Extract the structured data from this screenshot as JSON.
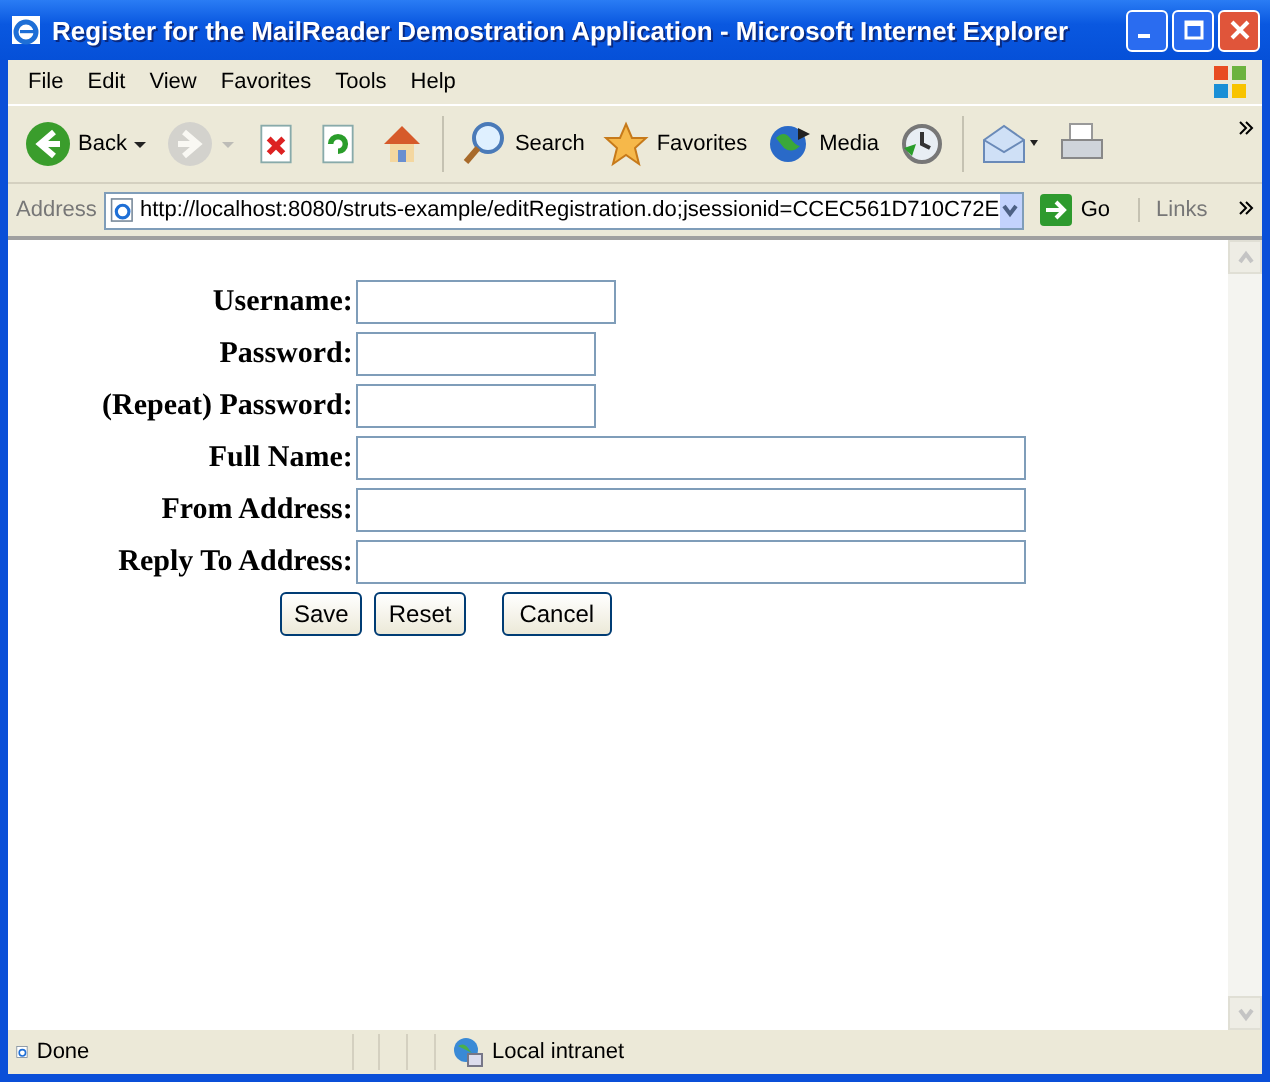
{
  "window": {
    "title": "Register for the MailReader Demostration Application - Microsoft Internet Explorer"
  },
  "menu": [
    "File",
    "Edit",
    "View",
    "Favorites",
    "Tools",
    "Help"
  ],
  "toolbar": [
    {
      "kind": "back",
      "label": "Back",
      "disabled": false
    },
    {
      "kind": "forward",
      "disabled": true
    },
    {
      "kind": "stop",
      "disabled": false
    },
    {
      "kind": "refresh",
      "disabled": false
    },
    {
      "kind": "home",
      "disabled": false
    },
    {
      "kind": "search",
      "label": "Search",
      "disabled": false
    },
    {
      "kind": "favorites",
      "label": "Favorites",
      "disabled": false
    },
    {
      "kind": "media",
      "label": "Media",
      "disabled": false
    },
    {
      "kind": "history",
      "disabled": false
    },
    {
      "kind": "mail",
      "disabled": false
    },
    {
      "kind": "print",
      "disabled": false
    }
  ],
  "address": {
    "label": "Address",
    "url": "http://localhost:8080/struts-example/editRegistration.do;jsessionid=CCEC561D710C72E",
    "go": "Go",
    "links": "Links"
  },
  "form": {
    "fields": [
      {
        "label": "Username:"
      },
      {
        "label": "Password:"
      },
      {
        "label": "(Repeat) Password:"
      },
      {
        "label": "Full Name:"
      },
      {
        "label": "From Address:"
      },
      {
        "label": "Reply To Address:"
      }
    ],
    "buttons": [
      "Save",
      "Reset",
      "Cancel"
    ]
  },
  "status_bar": {
    "text": "Done",
    "zone": "Local intranet"
  }
}
